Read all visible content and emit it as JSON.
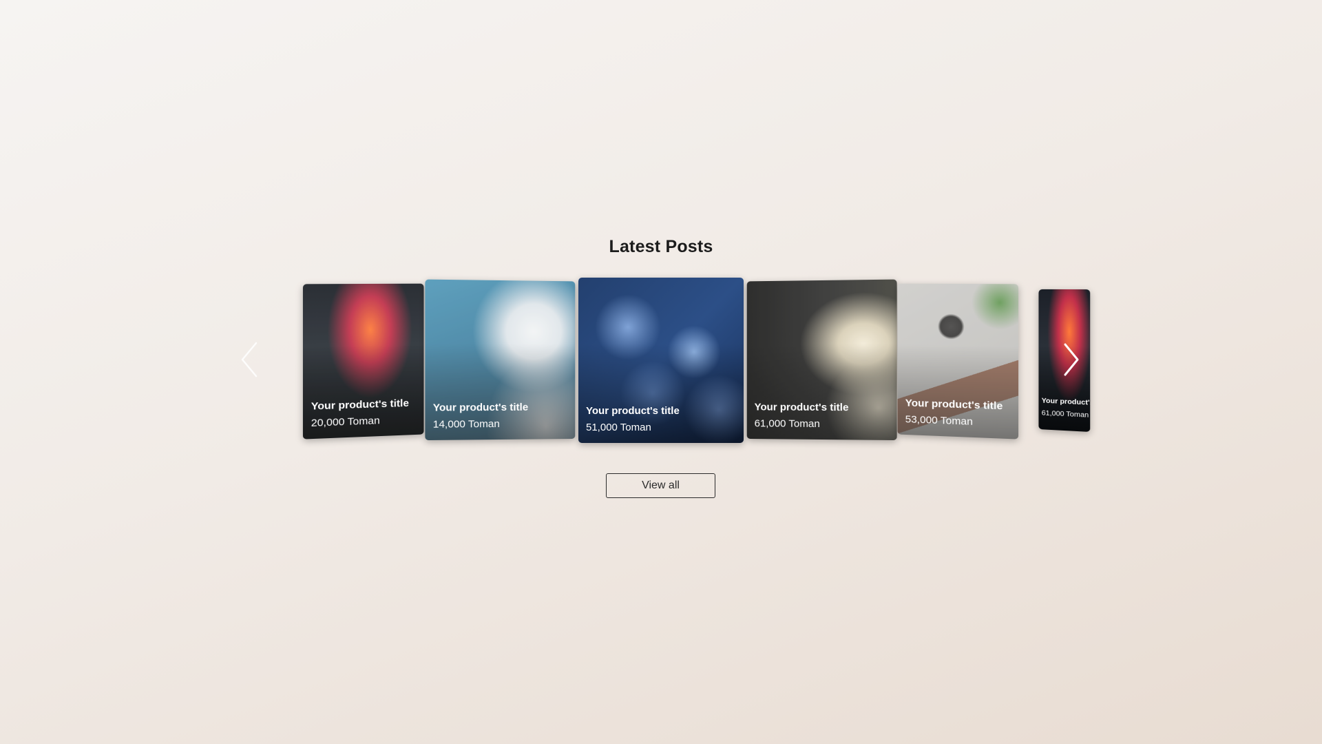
{
  "section": {
    "title": "Latest Posts"
  },
  "carousel": {
    "cards": [
      {
        "title": "Your product's title",
        "price": "20,000 Toman"
      },
      {
        "title": "Your product's title",
        "price": "14,000 Toman"
      },
      {
        "title": "Your product's title",
        "price": "51,000 Toman"
      },
      {
        "title": "Your product's title",
        "price": "61,000 Toman"
      },
      {
        "title": "Your product's title",
        "price": "53,000 Toman"
      },
      {
        "title": "Your product's title",
        "price": "61,000 Toman"
      }
    ],
    "prev_icon": "chevron-left-icon",
    "next_icon": "chevron-right-icon"
  },
  "view_all": {
    "label": "View all"
  }
}
